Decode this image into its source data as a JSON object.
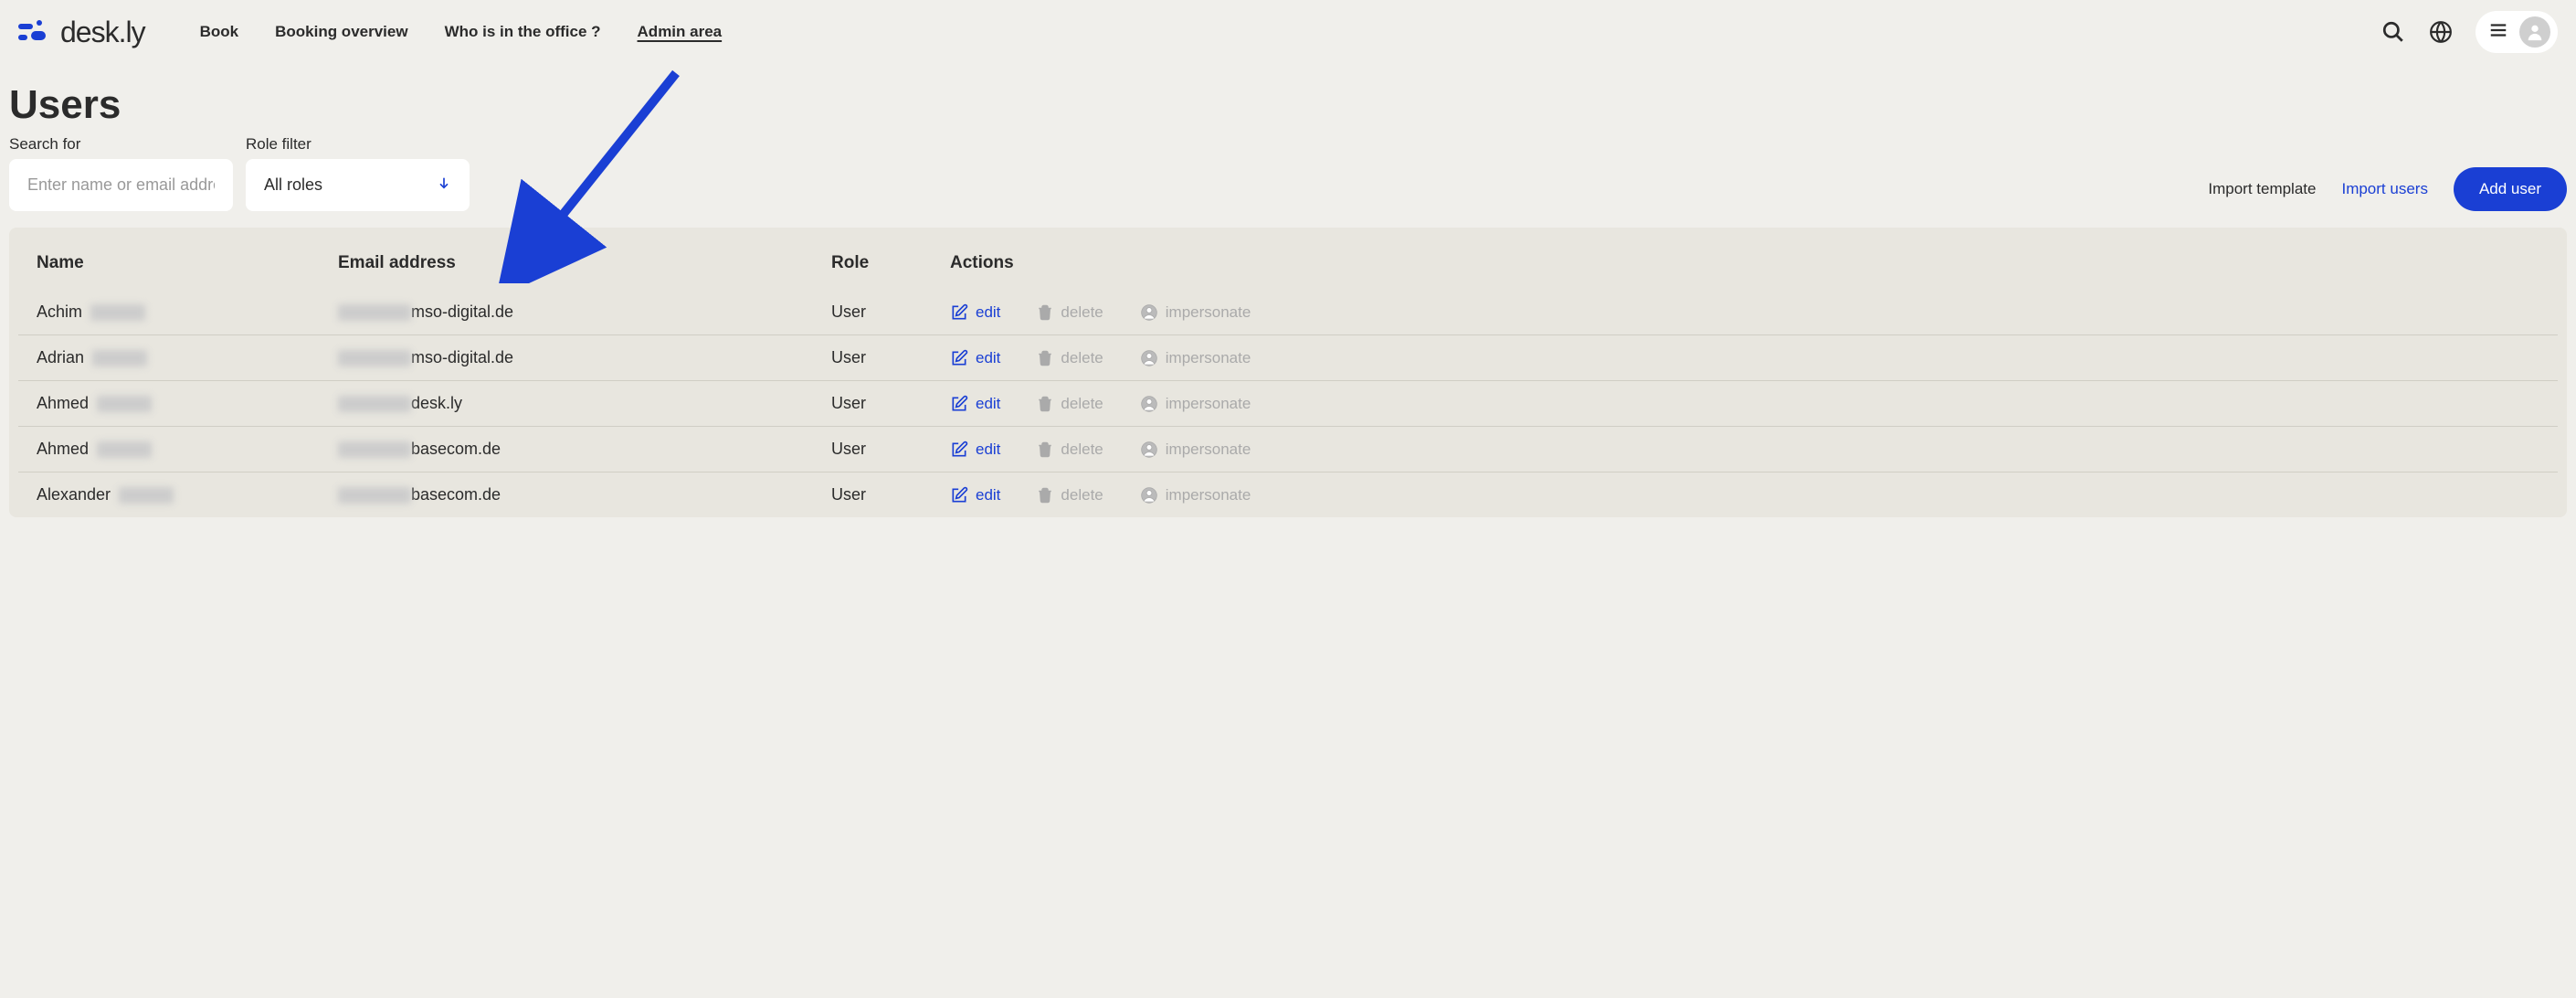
{
  "brand": "desk.ly",
  "nav": {
    "book": "Book",
    "booking_overview": "Booking overview",
    "who_office": "Who is in the office ?",
    "admin_area": "Admin area"
  },
  "page": {
    "title": "Users"
  },
  "filters": {
    "search_label": "Search for",
    "search_placeholder": "Enter name or email address",
    "role_label": "Role filter",
    "role_value": "All roles"
  },
  "actions": {
    "import_template": "Import template",
    "import_users": "Import users",
    "add_user": "Add user"
  },
  "table": {
    "headers": {
      "name": "Name",
      "email": "Email address",
      "role": "Role",
      "actions": "Actions"
    },
    "action_labels": {
      "edit": "edit",
      "delete": "delete",
      "impersonate": "impersonate"
    },
    "rows": [
      {
        "name_visible": "Achim",
        "email_visible": "mso-digital.de",
        "role": "User"
      },
      {
        "name_visible": "Adrian",
        "email_visible": "mso-digital.de",
        "role": "User"
      },
      {
        "name_visible": "Ahmed",
        "email_visible": "desk.ly",
        "role": "User"
      },
      {
        "name_visible": "Ahmed",
        "email_visible": "basecom.de",
        "role": "User"
      },
      {
        "name_visible": "Alexander",
        "email_visible": "basecom.de",
        "role": "User"
      }
    ]
  }
}
